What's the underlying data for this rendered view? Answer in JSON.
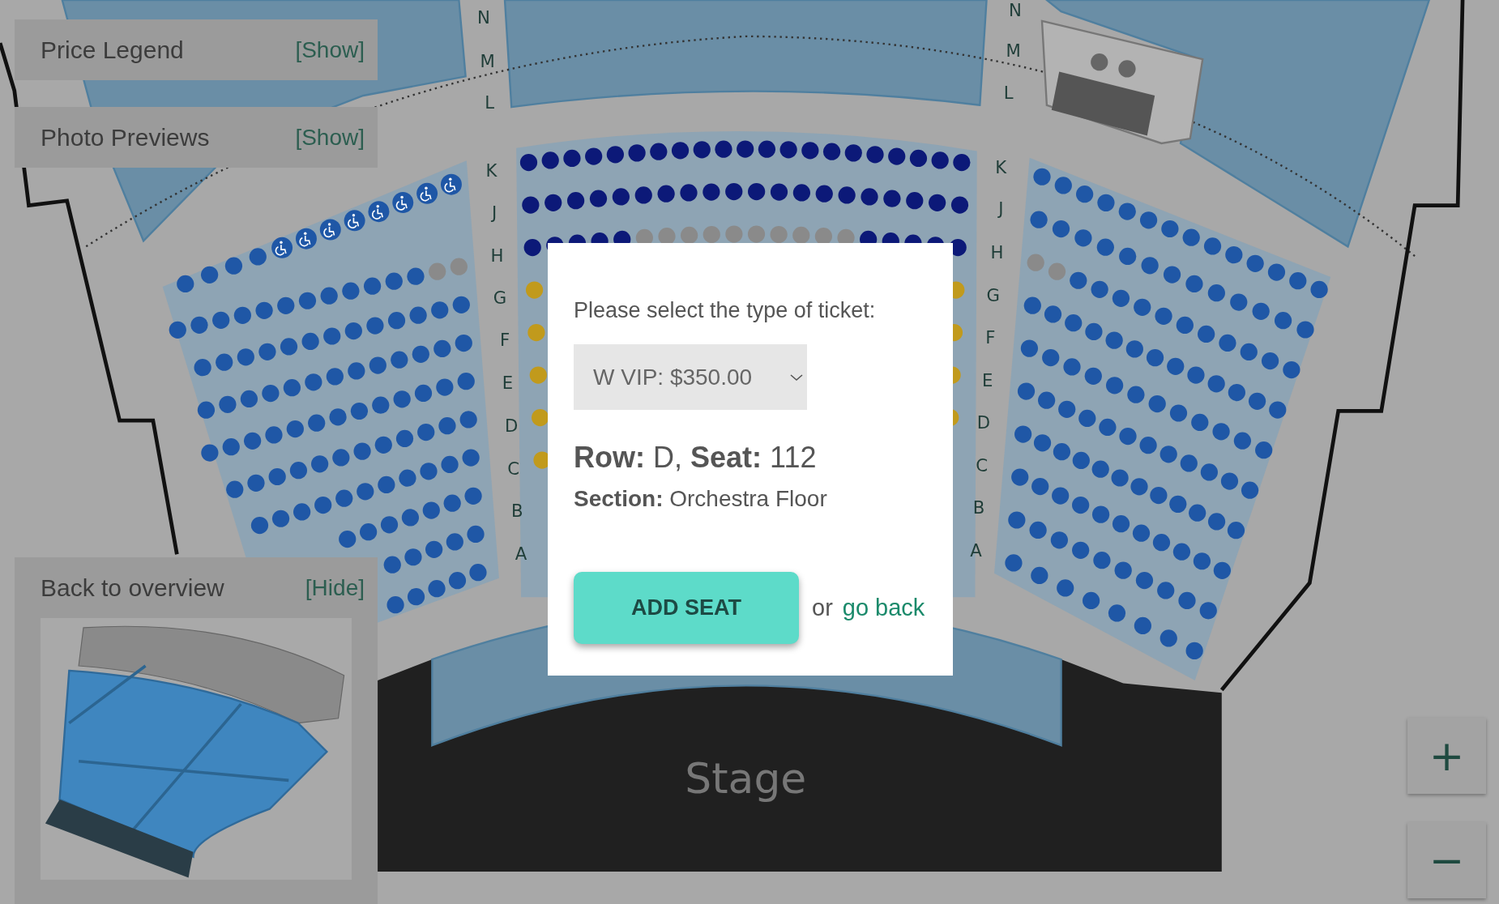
{
  "map": {
    "row_labels_left": [
      "N",
      "M",
      "L",
      "K",
      "J",
      "H",
      "G",
      "F",
      "E",
      "D",
      "C",
      "B",
      "A"
    ],
    "row_labels_right": [
      "N",
      "M",
      "L",
      "K",
      "J",
      "H",
      "G",
      "F",
      "E",
      "D",
      "C",
      "B",
      "A"
    ],
    "stage_label": "Stage",
    "sections": [
      {
        "kind": "left",
        "rows": [
          {
            "seats": [
              {
                "kind": "seat",
                "color": "#1f57a6"
              },
              {
                "kind": "seat",
                "color": "#1f57a6"
              },
              {
                "kind": "seat",
                "color": "#1f57a6"
              },
              {
                "kind": "seat",
                "color": "#1f57a6"
              },
              {
                "kind": "accessible",
                "color": "#1f57a6"
              },
              {
                "kind": "accessible",
                "color": "#1f57a6"
              },
              {
                "kind": "accessible",
                "color": "#1f57a6"
              },
              {
                "kind": "accessible",
                "color": "#1f57a6"
              },
              {
                "kind": "accessible",
                "color": "#1f57a6"
              },
              {
                "kind": "accessible",
                "color": "#1f57a6"
              },
              {
                "kind": "accessible",
                "color": "#1f57a6"
              },
              {
                "kind": "accessible",
                "color": "#1f57a6"
              }
            ]
          },
          {
            "seats": [
              {
                "color": "#1f57a6"
              },
              {
                "color": "#1f57a6"
              },
              {
                "color": "#1f57a6"
              },
              {
                "color": "#1f57a6"
              },
              {
                "color": "#1f57a6"
              },
              {
                "color": "#1f57a6"
              },
              {
                "color": "#1f57a6"
              },
              {
                "color": "#1f57a6"
              },
              {
                "color": "#1f57a6"
              },
              {
                "color": "#1f57a6"
              },
              {
                "color": "#1f57a6"
              },
              {
                "color": "#1f57a6"
              },
              {
                "color": "#8a8a8a"
              },
              {
                "color": "#8a8a8a"
              }
            ]
          },
          {
            "seats": [
              {
                "color": "#1f57a6"
              },
              {
                "color": "#1f57a6"
              },
              {
                "color": "#1f57a6"
              },
              {
                "color": "#1f57a6"
              },
              {
                "color": "#1f57a6"
              },
              {
                "color": "#1f57a6"
              },
              {
                "color": "#1f57a6"
              },
              {
                "color": "#1f57a6"
              },
              {
                "color": "#1f57a6"
              },
              {
                "color": "#1f57a6"
              },
              {
                "color": "#1f57a6"
              },
              {
                "color": "#1f57a6"
              },
              {
                "color": "#1f57a6"
              }
            ]
          },
          {
            "seats": [
              {
                "color": "#1f57a6"
              },
              {
                "color": "#1f57a6"
              },
              {
                "color": "#1f57a6"
              },
              {
                "color": "#1f57a6"
              },
              {
                "color": "#1f57a6"
              },
              {
                "color": "#1f57a6"
              },
              {
                "color": "#1f57a6"
              },
              {
                "color": "#1f57a6"
              },
              {
                "color": "#1f57a6"
              },
              {
                "color": "#1f57a6"
              },
              {
                "color": "#1f57a6"
              },
              {
                "color": "#1f57a6"
              },
              {
                "color": "#1f57a6"
              }
            ]
          },
          {
            "seats": [
              {
                "color": "#1f57a6"
              },
              {
                "color": "#1f57a6"
              },
              {
                "color": "#1f57a6"
              },
              {
                "color": "#1f57a6"
              },
              {
                "color": "#1f57a6"
              },
              {
                "color": "#1f57a6"
              },
              {
                "color": "#1f57a6"
              },
              {
                "color": "#1f57a6"
              },
              {
                "color": "#1f57a6"
              },
              {
                "color": "#1f57a6"
              },
              {
                "color": "#1f57a6"
              },
              {
                "color": "#1f57a6"
              },
              {
                "color": "#1f57a6"
              }
            ]
          },
          {
            "seats": [
              {
                "color": "#1f57a6"
              },
              {
                "color": "#1f57a6"
              },
              {
                "color": "#1f57a6"
              },
              {
                "color": "#1f57a6"
              },
              {
                "color": "#1f57a6"
              },
              {
                "color": "#1f57a6"
              },
              {
                "color": "#1f57a6"
              },
              {
                "color": "#1f57a6"
              },
              {
                "color": "#1f57a6"
              },
              {
                "color": "#1f57a6"
              },
              {
                "color": "#1f57a6"
              },
              {
                "color": "#1f57a6"
              }
            ]
          },
          {
            "seats": [
              {
                "color": "#1f57a6"
              },
              {
                "color": "#1f57a6"
              },
              {
                "color": "#1f57a6"
              },
              {
                "color": "#1f57a6"
              },
              {
                "color": "#1f57a6"
              },
              {
                "color": "#1f57a6"
              },
              {
                "color": "#1f57a6"
              },
              {
                "color": "#1f57a6"
              },
              {
                "color": "#1f57a6"
              },
              {
                "color": "#1f57a6"
              },
              {
                "color": "#1f57a6"
              }
            ]
          },
          {
            "seats": [
              {
                "color": "#1f57a6"
              },
              {
                "color": "#1f57a6"
              },
              {
                "color": "#1f57a6"
              },
              {
                "color": "#1f57a6"
              },
              {
                "color": "#1f57a6"
              },
              {
                "color": "#1f57a6"
              },
              {
                "color": "#1f57a6"
              }
            ]
          },
          {
            "seats": [
              {
                "color": "#1f57a6"
              },
              {
                "color": "#1f57a6"
              },
              {
                "color": "#1f57a6"
              },
              {
                "color": "#1f57a6"
              },
              {
                "color": "#1f57a6"
              }
            ]
          },
          {
            "seats": [
              {
                "color": "#1f57a6"
              },
              {
                "color": "#1f57a6"
              },
              {
                "color": "#1f57a6"
              },
              {
                "color": "#1f57a6"
              },
              {
                "color": "#1f57a6"
              }
            ]
          }
        ]
      },
      {
        "kind": "center",
        "rows": [
          {
            "seats": [
              {
                "color": "#0c1978"
              },
              {
                "color": "#0c1978"
              },
              {
                "color": "#0c1978"
              },
              {
                "color": "#0c1978"
              },
              {
                "color": "#0c1978"
              },
              {
                "color": "#0c1978"
              },
              {
                "color": "#0c1978"
              },
              {
                "color": "#0c1978"
              },
              {
                "color": "#0c1978"
              },
              {
                "color": "#0c1978"
              },
              {
                "color": "#0c1978"
              },
              {
                "color": "#0c1978"
              },
              {
                "color": "#0c1978"
              },
              {
                "color": "#0c1978"
              },
              {
                "color": "#0c1978"
              },
              {
                "color": "#0c1978"
              },
              {
                "color": "#0c1978"
              },
              {
                "color": "#0c1978"
              },
              {
                "color": "#0c1978"
              },
              {
                "color": "#0c1978"
              },
              {
                "color": "#0c1978"
              }
            ]
          },
          {
            "seats": [
              {
                "color": "#0c1978"
              },
              {
                "color": "#0c1978"
              },
              {
                "color": "#0c1978"
              },
              {
                "color": "#0c1978"
              },
              {
                "color": "#0c1978"
              },
              {
                "color": "#0c1978"
              },
              {
                "color": "#0c1978"
              },
              {
                "color": "#0c1978"
              },
              {
                "color": "#0c1978"
              },
              {
                "color": "#0c1978"
              },
              {
                "color": "#0c1978"
              },
              {
                "color": "#0c1978"
              },
              {
                "color": "#0c1978"
              },
              {
                "color": "#0c1978"
              },
              {
                "color": "#0c1978"
              },
              {
                "color": "#0c1978"
              },
              {
                "color": "#0c1978"
              },
              {
                "color": "#0c1978"
              },
              {
                "color": "#0c1978"
              },
              {
                "color": "#0c1978"
              }
            ]
          },
          {
            "seats": [
              {
                "color": "#0c1978"
              },
              {
                "color": "#0c1978"
              },
              {
                "color": "#0c1978"
              },
              {
                "color": "#0c1978"
              },
              {
                "color": "#0c1978"
              },
              {
                "color": "#8a8a8a"
              },
              {
                "color": "#8a8a8a"
              },
              {
                "color": "#8a8a8a"
              },
              {
                "color": "#8a8a8a"
              },
              {
                "color": "#8a8a8a"
              },
              {
                "color": "#8a8a8a"
              },
              {
                "color": "#8a8a8a"
              },
              {
                "color": "#8a8a8a"
              },
              {
                "color": "#8a8a8a"
              },
              {
                "color": "#8a8a8a"
              },
              {
                "color": "#0c1978"
              },
              {
                "color": "#0c1978"
              },
              {
                "color": "#0c1978"
              },
              {
                "color": "#0c1978"
              },
              {
                "color": "#0c1978"
              }
            ]
          },
          {
            "seats": [
              {
                "color": "#c19a1c"
              },
              {
                "color": "#c19a1c"
              }
            ]
          },
          {
            "seats": [
              {
                "color": "#c19a1c"
              },
              {
                "color": "#c19a1c"
              }
            ]
          },
          {
            "seats": [
              {
                "color": "#c19a1c"
              },
              {
                "color": "#c19a1c"
              }
            ]
          },
          {
            "seats": [
              {
                "color": "#c19a1c"
              },
              {
                "color": "#c19a1c"
              }
            ]
          },
          {
            "seats": [
              {
                "color": "#c19a1c"
              }
            ]
          }
        ]
      },
      {
        "kind": "right",
        "rows": [
          {
            "seats": [
              {
                "color": "#1f57a6"
              },
              {
                "color": "#1f57a6"
              },
              {
                "color": "#1f57a6"
              },
              {
                "color": "#1f57a6"
              },
              {
                "color": "#1f57a6"
              },
              {
                "color": "#1f57a6"
              },
              {
                "color": "#1f57a6"
              },
              {
                "color": "#1f57a6"
              },
              {
                "color": "#1f57a6"
              },
              {
                "color": "#1f57a6"
              },
              {
                "color": "#1f57a6"
              },
              {
                "color": "#1f57a6"
              },
              {
                "color": "#1f57a6"
              },
              {
                "color": "#1f57a6"
              }
            ]
          },
          {
            "seats": [
              {
                "color": "#1f57a6"
              },
              {
                "color": "#1f57a6"
              },
              {
                "color": "#1f57a6"
              },
              {
                "color": "#1f57a6"
              },
              {
                "color": "#1f57a6"
              },
              {
                "color": "#1f57a6"
              },
              {
                "color": "#1f57a6"
              },
              {
                "color": "#1f57a6"
              },
              {
                "color": "#1f57a6"
              },
              {
                "color": "#1f57a6"
              },
              {
                "color": "#1f57a6"
              },
              {
                "color": "#1f57a6"
              },
              {
                "color": "#1f57a6"
              }
            ]
          },
          {
            "seats": [
              {
                "color": "#8a8a8a"
              },
              {
                "color": "#8a8a8a"
              },
              {
                "color": "#1f57a6"
              },
              {
                "color": "#1f57a6"
              },
              {
                "color": "#1f57a6"
              },
              {
                "color": "#1f57a6"
              },
              {
                "color": "#1f57a6"
              },
              {
                "color": "#1f57a6"
              },
              {
                "color": "#1f57a6"
              },
              {
                "color": "#1f57a6"
              },
              {
                "color": "#1f57a6"
              },
              {
                "color": "#1f57a6"
              },
              {
                "color": "#1f57a6"
              }
            ]
          },
          {
            "seats": [
              {
                "color": "#1f57a6"
              },
              {
                "color": "#1f57a6"
              },
              {
                "color": "#1f57a6"
              },
              {
                "color": "#1f57a6"
              },
              {
                "color": "#1f57a6"
              },
              {
                "color": "#1f57a6"
              },
              {
                "color": "#1f57a6"
              },
              {
                "color": "#1f57a6"
              },
              {
                "color": "#1f57a6"
              },
              {
                "color": "#1f57a6"
              },
              {
                "color": "#1f57a6"
              },
              {
                "color": "#1f57a6"
              },
              {
                "color": "#1f57a6"
              }
            ]
          },
          {
            "seats": [
              {
                "color": "#1f57a6"
              },
              {
                "color": "#1f57a6"
              },
              {
                "color": "#1f57a6"
              },
              {
                "color": "#1f57a6"
              },
              {
                "color": "#1f57a6"
              },
              {
                "color": "#1f57a6"
              },
              {
                "color": "#1f57a6"
              },
              {
                "color": "#1f57a6"
              },
              {
                "color": "#1f57a6"
              },
              {
                "color": "#1f57a6"
              },
              {
                "color": "#1f57a6"
              },
              {
                "color": "#1f57a6"
              }
            ]
          },
          {
            "seats": [
              {
                "color": "#1f57a6"
              },
              {
                "color": "#1f57a6"
              },
              {
                "color": "#1f57a6"
              },
              {
                "color": "#1f57a6"
              },
              {
                "color": "#1f57a6"
              },
              {
                "color": "#1f57a6"
              },
              {
                "color": "#1f57a6"
              },
              {
                "color": "#1f57a6"
              },
              {
                "color": "#1f57a6"
              },
              {
                "color": "#1f57a6"
              },
              {
                "color": "#1f57a6"
              },
              {
                "color": "#1f57a6"
              }
            ]
          },
          {
            "seats": [
              {
                "color": "#1f57a6"
              },
              {
                "color": "#1f57a6"
              },
              {
                "color": "#1f57a6"
              },
              {
                "color": "#1f57a6"
              },
              {
                "color": "#1f57a6"
              },
              {
                "color": "#1f57a6"
              },
              {
                "color": "#1f57a6"
              },
              {
                "color": "#1f57a6"
              },
              {
                "color": "#1f57a6"
              },
              {
                "color": "#1f57a6"
              },
              {
                "color": "#1f57a6"
              },
              {
                "color": "#1f57a6"
              }
            ]
          },
          {
            "seats": [
              {
                "color": "#1f57a6"
              },
              {
                "color": "#1f57a6"
              },
              {
                "color": "#1f57a6"
              },
              {
                "color": "#1f57a6"
              },
              {
                "color": "#1f57a6"
              },
              {
                "color": "#1f57a6"
              },
              {
                "color": "#1f57a6"
              },
              {
                "color": "#1f57a6"
              },
              {
                "color": "#1f57a6"
              },
              {
                "color": "#1f57a6"
              },
              {
                "color": "#1f57a6"
              }
            ]
          },
          {
            "seats": [
              {
                "color": "#1f57a6"
              },
              {
                "color": "#1f57a6"
              },
              {
                "color": "#1f57a6"
              },
              {
                "color": "#1f57a6"
              },
              {
                "color": "#1f57a6"
              },
              {
                "color": "#1f57a6"
              },
              {
                "color": "#1f57a6"
              },
              {
                "color": "#1f57a6"
              },
              {
                "color": "#1f57a6"
              },
              {
                "color": "#1f57a6"
              }
            ]
          },
          {
            "seats": [
              {
                "color": "#1f57a6"
              },
              {
                "color": "#1f57a6"
              },
              {
                "color": "#1f57a6"
              },
              {
                "color": "#1f57a6"
              },
              {
                "color": "#1f57a6"
              },
              {
                "color": "#1f57a6"
              },
              {
                "color": "#1f57a6"
              },
              {
                "color": "#1f57a6"
              }
            ]
          }
        ]
      }
    ]
  },
  "panels": [
    {
      "title": "Price Legend",
      "toggle": "[Show]"
    },
    {
      "title": "Photo Previews",
      "toggle": "[Show]"
    }
  ],
  "overview": {
    "title": "Back to overview",
    "toggle": "[Hide]"
  },
  "zoom": {
    "zoom_in": "+",
    "zoom_out": "−"
  },
  "dialog": {
    "prompt": "Please select the type of ticket:",
    "ticket_type": "W VIP: $350.00",
    "seat_line": "**Row:** D, **Seat:** 112",
    "section_line": "**Section:** Orchestra Floor",
    "add_button": "ADD SEAT",
    "or_text": "or",
    "back_link": "go back"
  }
}
